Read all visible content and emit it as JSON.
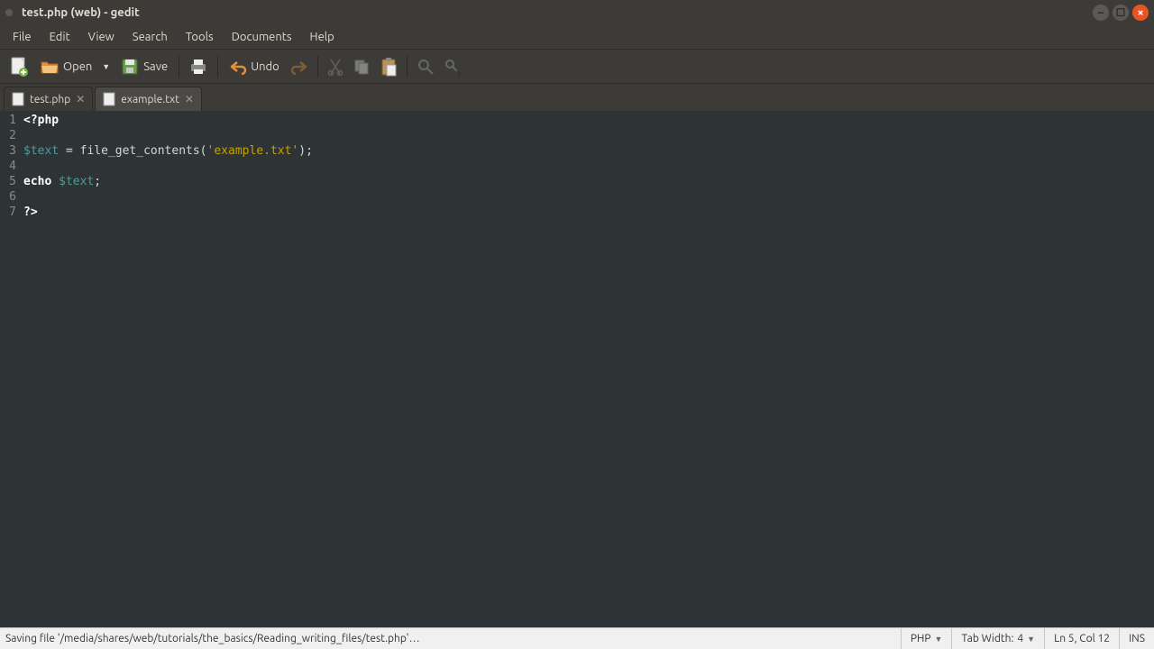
{
  "window": {
    "title": "test.php (web) - gedit"
  },
  "menubar": {
    "items": [
      "File",
      "Edit",
      "View",
      "Search",
      "Tools",
      "Documents",
      "Help"
    ]
  },
  "toolbar": {
    "open_label": "Open",
    "save_label": "Save",
    "undo_label": "Undo"
  },
  "tabs": [
    {
      "label": "test.php",
      "active": true
    },
    {
      "label": "example.txt",
      "active": false
    }
  ],
  "code": {
    "lines": [
      "1",
      "2",
      "3",
      "4",
      "5",
      "6",
      "7"
    ],
    "l1_kw": "<?php",
    "l3_var": "$text",
    "l3_eq": " = ",
    "l3_fn": "file_get_contents(",
    "l3_str": "'example.txt'",
    "l3_end": ");",
    "l5_kw": "echo",
    "l5_sp": " ",
    "l5_var": "$text",
    "l5_end": ";",
    "l7_kw": "?>"
  },
  "statusbar": {
    "message": "Saving file '/media/shares/web/tutorials/the_basics/Reading_writing_files/test.php'…",
    "language": "PHP",
    "tabwidth_label": "Tab Width:",
    "tabwidth_value": "4",
    "position": "Ln 5, Col 12",
    "mode": "INS"
  }
}
